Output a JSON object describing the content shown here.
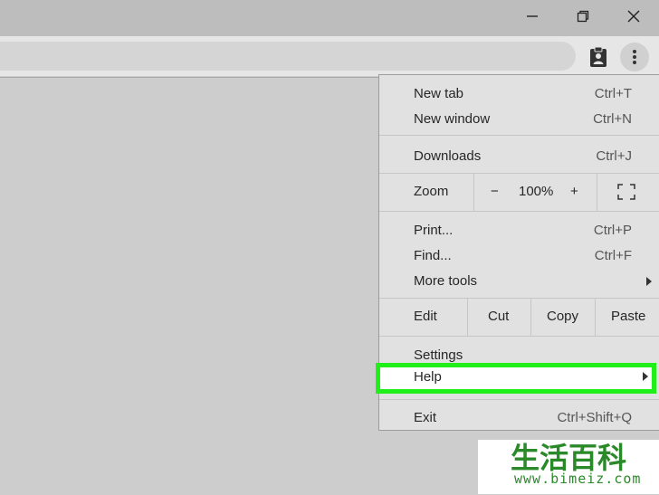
{
  "window": {
    "minimize_icon": "minimize-icon",
    "restore_icon": "restore-icon",
    "close_icon": "close-icon"
  },
  "toolbar": {
    "extension_icon": "clipboard-person-icon",
    "menu_icon": "three-dots-vertical-icon"
  },
  "menu": {
    "new_tab": {
      "label": "New tab",
      "shortcut": "Ctrl+T"
    },
    "new_window": {
      "label": "New window",
      "shortcut": "Ctrl+N"
    },
    "downloads": {
      "label": "Downloads",
      "shortcut": "Ctrl+J"
    },
    "zoom": {
      "label": "Zoom",
      "minus": "−",
      "value": "100%",
      "plus": "+",
      "fullscreen_icon": "fullscreen-icon"
    },
    "print": {
      "label": "Print...",
      "shortcut": "Ctrl+P"
    },
    "find": {
      "label": "Find...",
      "shortcut": "Ctrl+F"
    },
    "more_tools": {
      "label": "More tools"
    },
    "edit": {
      "label": "Edit",
      "cut": "Cut",
      "copy": "Copy",
      "paste": "Paste"
    },
    "settings": {
      "label": "Settings"
    },
    "help": {
      "label": "Help"
    },
    "exit": {
      "label": "Exit",
      "shortcut": "Ctrl+Shift+Q"
    }
  },
  "highlight_color": "#21ef1a",
  "watermark": {
    "chars": "生活百科",
    "url": "www.bimeiz.com"
  }
}
